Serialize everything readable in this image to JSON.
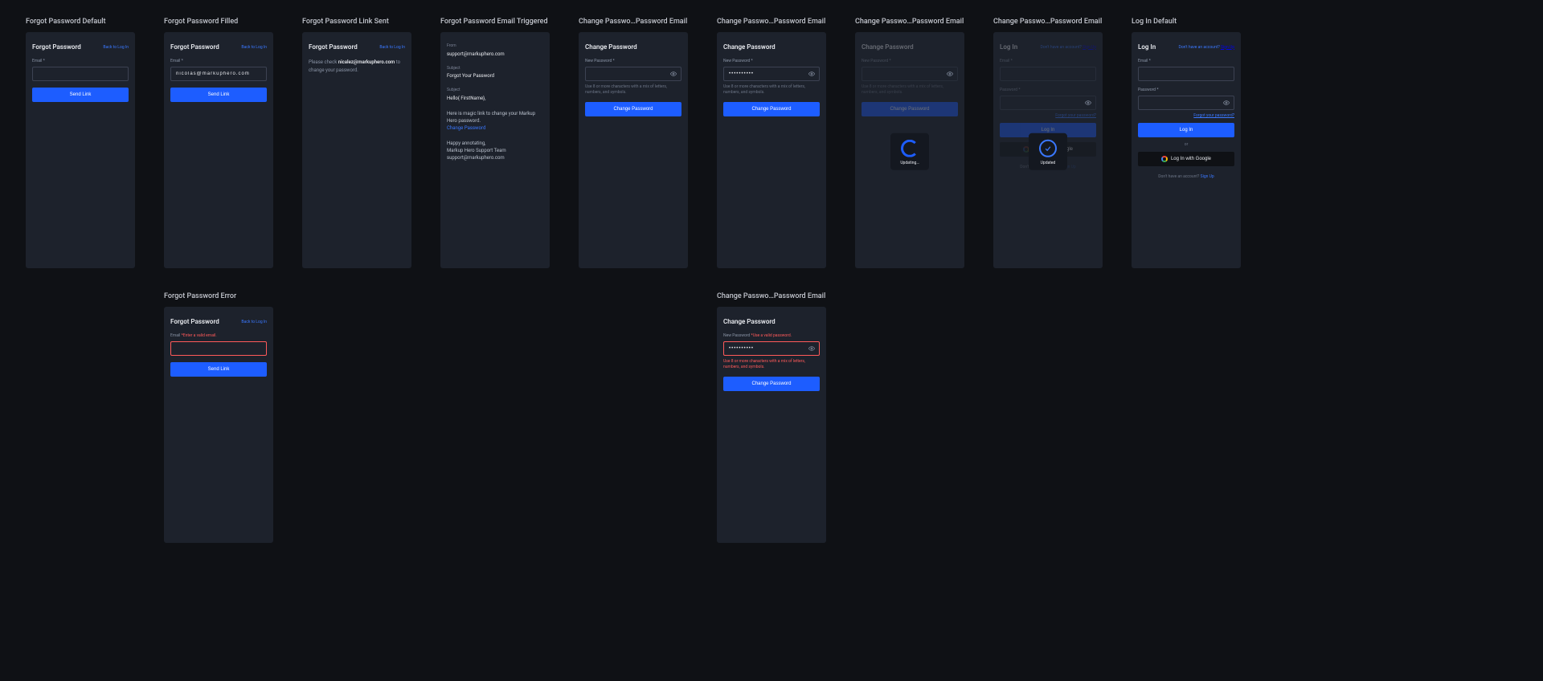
{
  "screens": {
    "fp_default": {
      "label": "Forgot Password Default",
      "title": "Forgot Password",
      "back": "Back to Log In",
      "email_label": "Email *",
      "email_value": "",
      "submit": "Send Link"
    },
    "fp_filled": {
      "label": "Forgot Password Filled",
      "title": "Forgot Password",
      "back": "Back to Log In",
      "email_label": "Email *",
      "email_value": "nicolas@markuphero.com",
      "submit": "Send Link"
    },
    "fp_sent": {
      "label": "Forgot Password Link Sent",
      "title": "Forgot Password",
      "back": "Back to Log In",
      "line_prefix": "Please check ",
      "line_email": "nicalez@markuphero.com",
      "line_suffix": " to change your password."
    },
    "fp_email": {
      "label": "Forgot Password Email Triggered",
      "from_label": "From",
      "from_value": "support@markuphero.com",
      "subject_label": "Subject",
      "subject_value": "Forgot Your Password",
      "subject2_label": "Subject",
      "greeting": "Hello{ FirstName},",
      "body1": "Here is magic link to change your Markup Hero password.",
      "link_text": "Change Password",
      "body2": "Happy annotating,",
      "body3": "Markup Hero Support Team",
      "body4": "support@markuphero.com"
    },
    "cp_default": {
      "label": "Change Passwo…Password Email",
      "title": "Change Password",
      "pw_label": "New Password *",
      "pw_value": "",
      "helper": "Use 8 or more characters with a mix of letters, numbers, and symbols.",
      "submit": "Change Password"
    },
    "cp_filled": {
      "label": "Change Passwo…Password Email",
      "title": "Change Password",
      "pw_label": "New Password *",
      "pw_value": "••••••••••",
      "helper": "Use 8 or more characters with a mix of letters, numbers, and symbols.",
      "submit": "Change Password"
    },
    "cp_updating": {
      "label": "Change Passwo…Password Email",
      "title": "Change Password",
      "pw_label": "New Password *",
      "pw_value": "",
      "helper": "Use 8 or more characters with a mix of letters, numbers, and symbols.",
      "submit": "Change Password",
      "toast": "Updating…"
    },
    "cp_updated": {
      "label": "Change Passwo…Password Email",
      "title": "Log In",
      "signup_prompt": "Don't have an account?",
      "signup_link": "Sign Up",
      "email_label": "Email *",
      "pw_label": "Password *",
      "forgot": "Forgot your password?",
      "submit": "Log In",
      "google": "Log In with Google",
      "bottom_prompt": "Don't have an account?",
      "bottom_link": "Sign Up",
      "toast": "Updated"
    },
    "login_default": {
      "label": "Log In Default",
      "title": "Log In",
      "signup_prompt": "Don't have an account?",
      "signup_link": "Sign Up",
      "email_label": "Email *",
      "pw_label": "Password *",
      "forgot": "Forgot your password?",
      "submit": "Log In",
      "or": "or",
      "google": "Log In with Google",
      "bottom_prompt": "Don't have an account?",
      "bottom_link": "Sign Up"
    },
    "fp_error": {
      "label": "Forgot Password Error",
      "title": "Forgot Password",
      "back": "Back to Log In",
      "email_label": "Email ",
      "email_error": "*Enter a valid email.",
      "email_value": "",
      "submit": "Send Link"
    },
    "cp_error": {
      "label": "Change Passwo…Password Email",
      "title": "Change Password",
      "pw_label": "New Password ",
      "pw_error": "*Use a valid password.",
      "pw_value": "••••••••••",
      "helper": "Use 8 or more characters with a mix of letters, numbers, and symbols.",
      "submit": "Change Password"
    }
  }
}
